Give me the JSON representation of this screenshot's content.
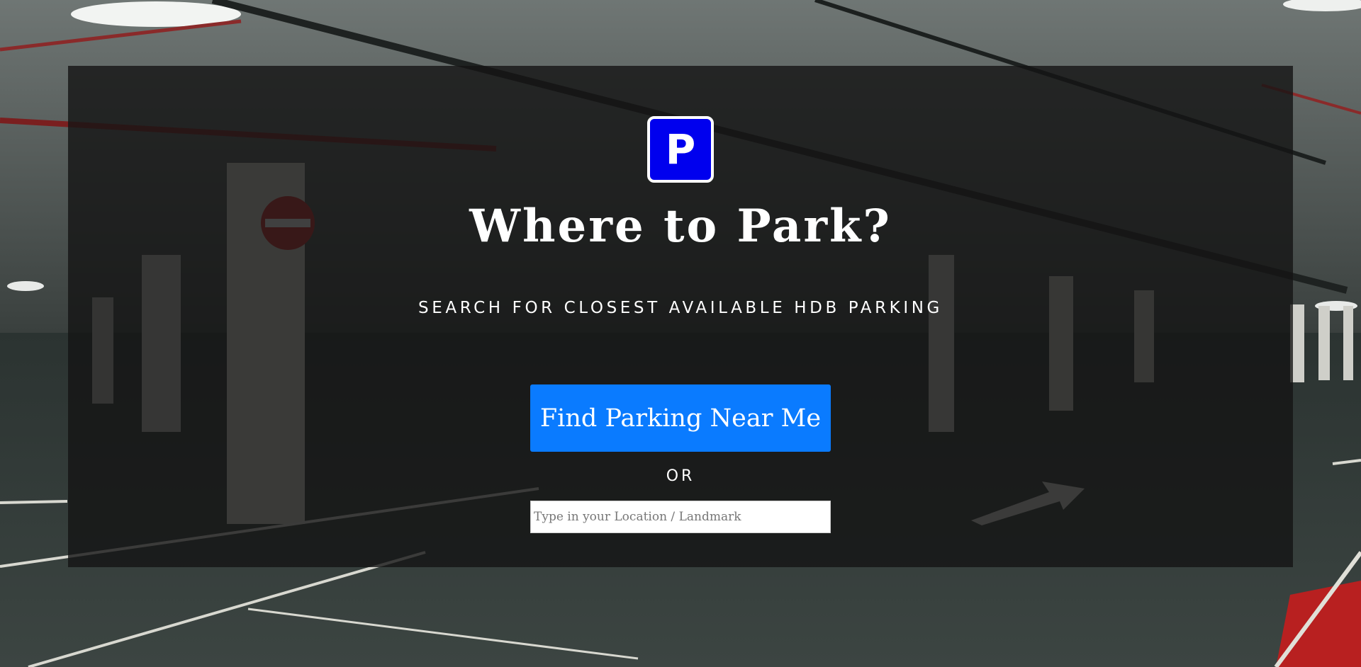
{
  "hero": {
    "logo_letter": "P",
    "title": "Where to Park?",
    "subtitle": "SEARCH FOR CLOSEST AVAILABLE HDB PARKING",
    "find_button_label": "Find Parking Near Me",
    "or_text": "OR",
    "location_placeholder": "Type in your Location / Landmark"
  },
  "colors": {
    "logo_background": "#0000ee",
    "button_background": "#0a7bff",
    "panel_overlay": "rgba(20,20,20,0.80)"
  }
}
